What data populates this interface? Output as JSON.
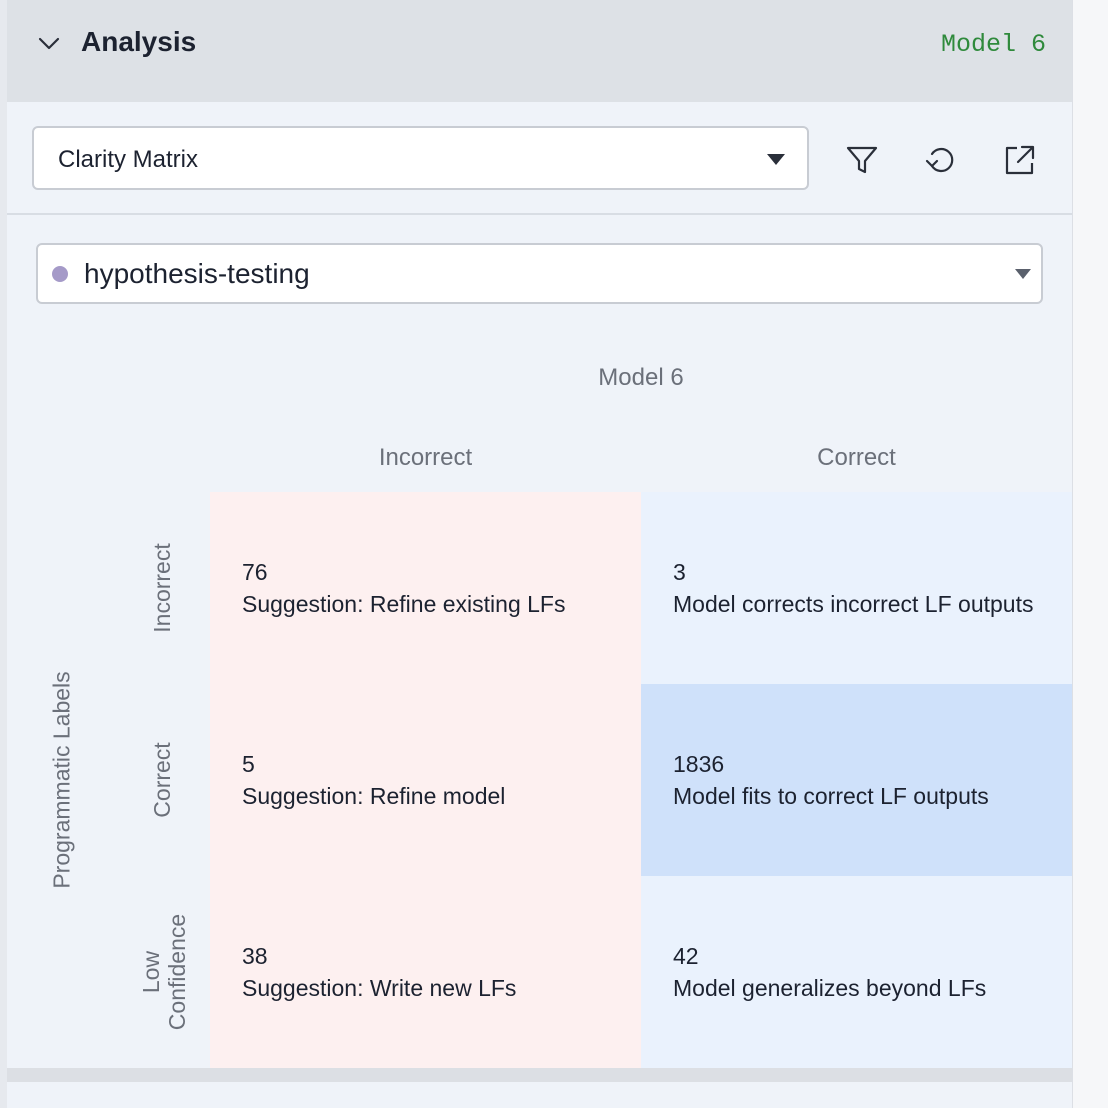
{
  "header": {
    "title": "Analysis",
    "model_label": "Model 6",
    "collapse_icon": "chevron-down-icon"
  },
  "toolbar": {
    "selected_view": "Clarity Matrix",
    "icons": [
      "filter-icon",
      "reset-icon",
      "external-link-icon"
    ]
  },
  "label_selector": {
    "value": "hypothesis-testing",
    "dot_color": "#a59ac8"
  },
  "matrix": {
    "column_title": "Model 6",
    "row_title": "Programmatic Labels",
    "columns": [
      "Incorrect",
      "Correct"
    ],
    "rows": [
      "Incorrect",
      "Correct",
      "Low Confidence"
    ],
    "cells": [
      [
        {
          "count": "76",
          "text": "Suggestion: Refine existing LFs"
        },
        {
          "count": "3",
          "text": "Model corrects incorrect LF outputs"
        }
      ],
      [
        {
          "count": "5",
          "text": "Suggestion: Refine model"
        },
        {
          "count": "1836",
          "text": "Model fits to correct LF outputs"
        }
      ],
      [
        {
          "count": "38",
          "text": "Suggestion: Write new LFs"
        },
        {
          "count": "42",
          "text": "Model generalizes beyond LFs"
        }
      ]
    ],
    "colors": {
      "incorrect_bg": "#fdf0f0",
      "correct_bg": "#eaf2fd",
      "highlight_bg": "#cfe1fa"
    }
  }
}
